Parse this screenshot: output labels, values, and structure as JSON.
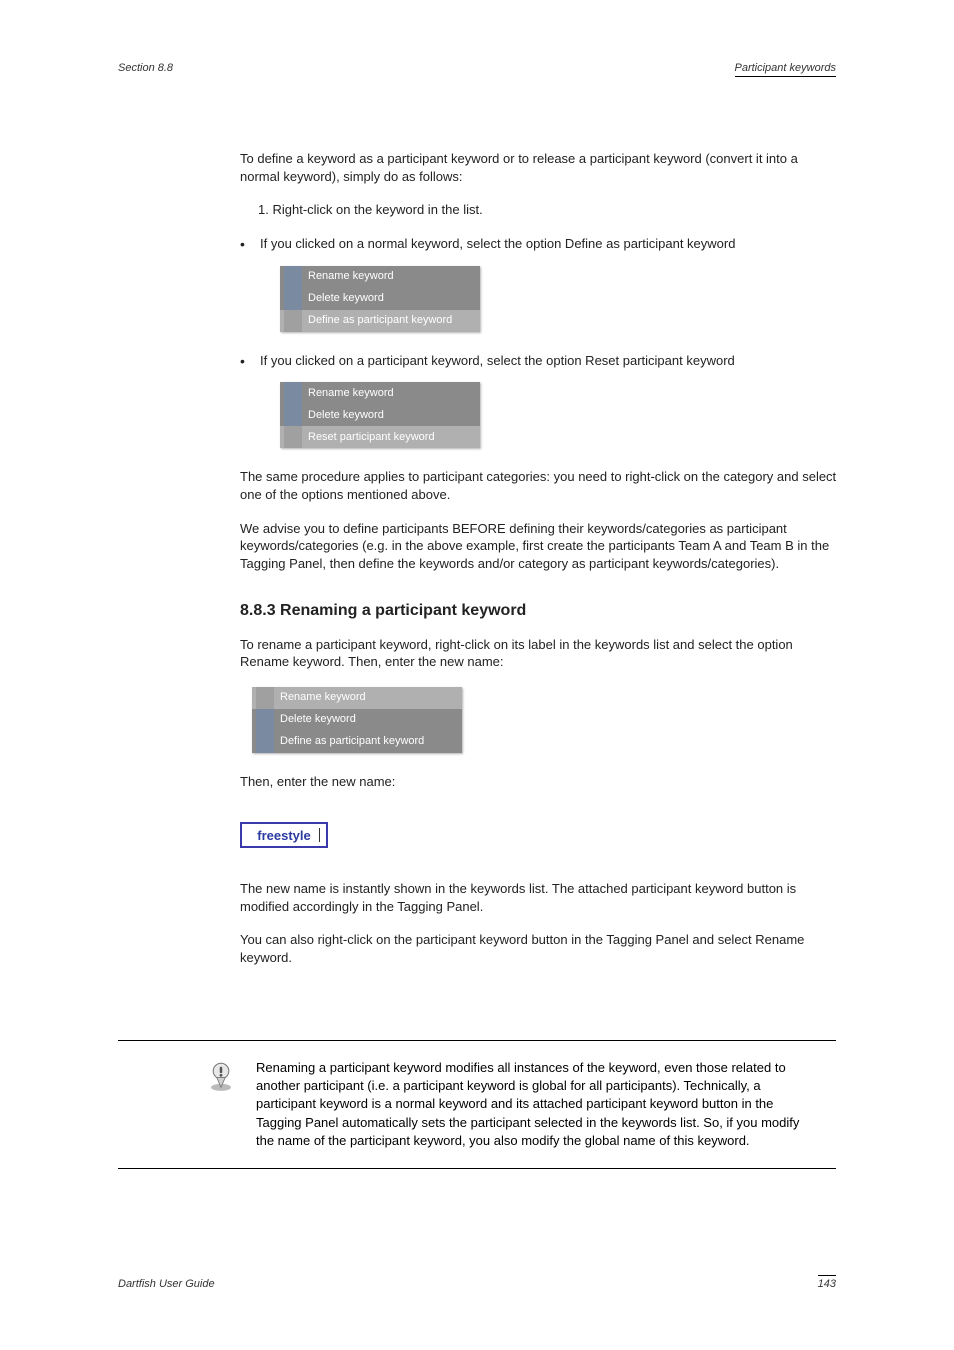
{
  "header": {
    "section": "Section 8.8",
    "title": "Participant keywords"
  },
  "footer": {
    "product": "Dartfish User Guide",
    "page": "143"
  },
  "intro": "To define a keyword as a participant keyword or to release a participant keyword (convert it into a normal keyword), simply do as follows:",
  "step1": "Right-click on the keyword in the list.",
  "bullet1": {
    "text": "If you clicked on a normal keyword, select the option Define as participant keyword",
    "menu": [
      "Rename keyword",
      "Delete keyword",
      "Define as participant keyword"
    ]
  },
  "bullet2": {
    "text": "If you clicked on a participant keyword, select the option Reset participant keyword",
    "menu": [
      "Rename keyword",
      "Delete keyword",
      "Reset participant keyword"
    ]
  },
  "note_after_bullets": "The same procedure applies to participant categories: you need to right-click on the category and select one of the options mentioned above.",
  "tip": "We advise you to define participants BEFORE defining their keywords/categories as participant keywords/categories (e.g. in the above example, first create the participants Team A and Team B in the Tagging Panel, then define the keywords and/or category as participant keywords/categories).",
  "rename_heading": "8.8.3 Renaming a participant keyword",
  "rename_instructions": "To rename a participant keyword, right-click on its label in the keywords list and select the option Rename keyword. Then, enter the new name:",
  "rename_menu": [
    "Rename keyword",
    "Delete keyword",
    "Define as participant keyword"
  ],
  "rename_input_value": "freestyle",
  "rename_para_after": "The new name is instantly shown in the keywords list. The attached participant keyword button is modified accordingly in the Tagging Panel.",
  "rename_para_last": "You can also right-click on the participant keyword button in the Tagging Panel and select Rename keyword.",
  "callout": "Renaming a participant keyword modifies all instances of the keyword, even those related to another participant (i.e. a participant keyword is global for all participants). Technically, a participant keyword is a normal keyword and its attached participant keyword button in the Tagging Panel automatically sets the participant selected in the keywords list. So, if you modify the name of the participant keyword, you also modify the global name of this keyword."
}
